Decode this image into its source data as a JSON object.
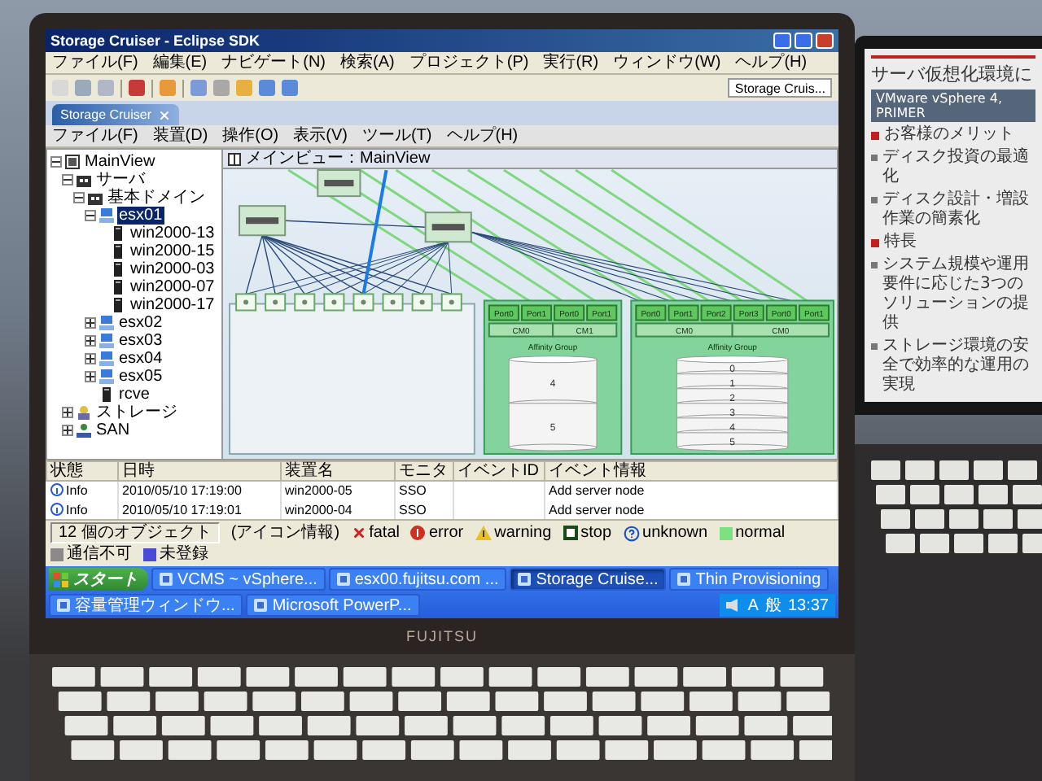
{
  "screen": {
    "window": {
      "title": "Storage Cruiser - Eclipse SDK"
    },
    "menu": [
      "ファイル(F)",
      "編集(E)",
      "ナビゲート(N)",
      "検索(A)",
      "プロジェクト(P)",
      "実行(R)",
      "ウィンドウ(W)",
      "ヘルプ(H)"
    ],
    "perspective": "Storage Cruis...",
    "view_tab": {
      "label": "Storage Cruiser"
    },
    "inner_menu": [
      "ファイル(F)",
      "装置(D)",
      "操作(O)",
      "表示(V)",
      "ツール(T)",
      "ヘルプ(H)"
    ],
    "tree": [
      {
        "label": "MainView",
        "kind": "root",
        "expanded": true,
        "selected": false,
        "children": [
          {
            "label": "サーバ",
            "kind": "folder",
            "expanded": true,
            "selected": false,
            "children": [
              {
                "label": "基本ドメイン",
                "kind": "folder",
                "expanded": true,
                "selected": false,
                "children": [
                  {
                    "label": "esx01",
                    "kind": "server",
                    "expanded": true,
                    "selected": true,
                    "children": [
                      {
                        "label": "win2000-13",
                        "kind": "host",
                        "selected": false
                      },
                      {
                        "label": "win2000-15",
                        "kind": "host",
                        "selected": false
                      },
                      {
                        "label": "win2000-03",
                        "kind": "host",
                        "selected": false
                      },
                      {
                        "label": "win2000-07",
                        "kind": "host",
                        "selected": false
                      },
                      {
                        "label": "win2000-17",
                        "kind": "host",
                        "selected": false
                      }
                    ]
                  },
                  {
                    "label": "esx02",
                    "kind": "server",
                    "expanded": false,
                    "selected": false
                  },
                  {
                    "label": "esx03",
                    "kind": "server",
                    "expanded": false,
                    "selected": false
                  },
                  {
                    "label": "esx04",
                    "kind": "server",
                    "expanded": false,
                    "selected": false
                  },
                  {
                    "label": "esx05",
                    "kind": "server",
                    "expanded": false,
                    "selected": false
                  },
                  {
                    "label": "rcve",
                    "kind": "host",
                    "selected": false
                  }
                ]
              }
            ]
          },
          {
            "label": "ストレージ",
            "kind": "storage",
            "expanded": false,
            "selected": false
          },
          {
            "label": "SAN",
            "kind": "san",
            "expanded": false,
            "selected": false
          }
        ]
      }
    ],
    "diagram": {
      "title": "メインビュー：MainView",
      "storage": [
        {
          "ports": [
            "Port0",
            "Port1",
            "Port0",
            "Port1"
          ],
          "cms": [
            "CM0",
            "CM1"
          ],
          "group": "Affinity Group",
          "volumes": [
            "4",
            "5"
          ]
        },
        {
          "ports": [
            "Port0",
            "Port1",
            "Port2",
            "Port3",
            "Port0",
            "Port1"
          ],
          "cms": [
            "CM0",
            "CM0"
          ],
          "group": "Affinity Group",
          "volumes": [
            "0",
            "1",
            "2",
            "3",
            "4",
            "5"
          ]
        }
      ]
    },
    "events": {
      "columns": [
        "状態",
        "日時",
        "装置名",
        "モニタ",
        "イベントID",
        "イベント情報"
      ],
      "rows": [
        {
          "level": "Info",
          "date": "2010/05/10 17:19:00",
          "device": "win2000-05",
          "monitor": "SSO",
          "event": "Add server node"
        },
        {
          "level": "Info",
          "date": "2010/05/10 17:19:01",
          "device": "win2000-04",
          "monitor": "SSO",
          "event": "Add server node"
        }
      ]
    },
    "status": {
      "count": "12 個のオブジェクト",
      "legend_title": "(アイコン情報)",
      "legend": [
        {
          "kind": "fatal",
          "label": "fatal"
        },
        {
          "kind": "error",
          "label": "error"
        },
        {
          "kind": "warning",
          "label": "warning"
        },
        {
          "kind": "stop",
          "label": "stop"
        },
        {
          "kind": "unknown",
          "label": "unknown"
        },
        {
          "kind": "swatch",
          "label": "normal",
          "color": "#7ee07e"
        },
        {
          "kind": "swatch",
          "label": "通信不可",
          "color": "#8a8a8a"
        },
        {
          "kind": "swatch",
          "label": "未登録",
          "color": "#4a4ad8"
        }
      ]
    },
    "taskbar": {
      "start": "スタート",
      "tasks": [
        {
          "label": "VCMS ~ vSphere...",
          "selected": false
        },
        {
          "label": "esx00.fujitsu.com ...",
          "selected": false
        },
        {
          "label": "Storage Cruise...",
          "selected": true
        },
        {
          "label": "Thin Provisioning",
          "selected": false
        },
        {
          "label": "容量管理ウィンドウ...",
          "selected": false
        },
        {
          "label": "Microsoft PowerP...",
          "selected": false
        }
      ],
      "tray": [
        "A",
        "般"
      ],
      "clock": "13:37"
    }
  },
  "bezel_logo": "FUJITSU",
  "slide": {
    "title": "サーバ仮想化環境に",
    "subtitle": "VMware vSphere 4, PRIMER",
    "items": [
      {
        "kind": "heading",
        "text": "お客様のメリット"
      },
      {
        "kind": "bullet",
        "text": "ディスク投資の最適化"
      },
      {
        "kind": "bullet",
        "text": "ディスク設計・増設作業の簡素化"
      },
      {
        "kind": "heading",
        "text": "特長"
      },
      {
        "kind": "bullet",
        "text": "システム規模や運用要件に応じた3つのソリューションの提供"
      },
      {
        "kind": "bullet",
        "text": "ストレージ環境の安全で効率的な運用の実現"
      }
    ]
  }
}
